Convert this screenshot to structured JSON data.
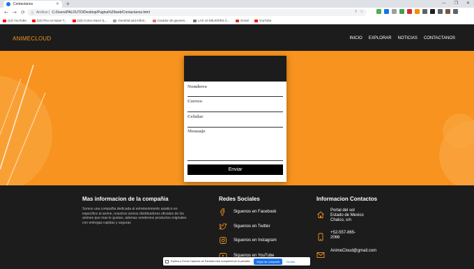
{
  "browser": {
    "tab_title": "Contactanos",
    "tab_close": "×",
    "new_tab": "+",
    "window_controls": [
      "—",
      "❐",
      "✕"
    ],
    "nav": {
      "back": "←",
      "forward": "→",
      "reload": "⟳"
    },
    "address": {
      "info_icon": "ⓘ",
      "scheme_label": "Archivo |",
      "url": "C:/Users/PALOUTO/Desktop/Pagina%20web/Contactanos.html"
    },
    "omnibox_actions": [
      "⇪",
      "☆"
    ],
    "bookmarks": [
      {
        "label": "(12) YouTube",
        "color": "#ff0000"
      },
      {
        "label": "(22) Pico vs Nane T...",
        "color": "#ff0000"
      },
      {
        "label": "(33) Como Hacer (L...",
        "color": "#ff0000"
      },
      {
        "label": "Genshid and Infinit...",
        "color": "#9e9e9e"
      },
      {
        "label": "Creador de guiones...",
        "color": "#e57373"
      },
      {
        "label": "LAS 10 MEJORES C...",
        "color": "#777777"
      },
      {
        "label": "Gmail",
        "color": "#d93025"
      },
      {
        "label": "YouTube",
        "color": "#ff0000"
      }
    ],
    "extension_colors": [
      "#4caf50",
      "#1a73e8",
      "#9e9e9e",
      "#43a047",
      "#d32f2f",
      "#fb8c00",
      "#5f6368",
      "#202124",
      "#5f6368",
      "#795548",
      "#5f6368"
    ]
  },
  "site": {
    "logo": "ANIMECLOUD",
    "menu": [
      "INICIO",
      "EXPLORAR",
      "NOTICIAS",
      "CONTACTANOS"
    ],
    "form": {
      "name_label": "Nombres",
      "email_label": "Correo",
      "phone_label": "Celular",
      "message_label": "Mensaje",
      "submit": "Enviar"
    },
    "footer": {
      "about_title": "Mas informacion de la compañia",
      "about_text": "Somos una compañia dedicada al entretenimiento asiatico en especifico al anime, nosotros somos distribuidores oficiales de los animes que mas le gustan, ademas vendemos productos originales con entregas rapidas y seguras",
      "social_title": "Redes Sociales",
      "social": [
        {
          "label": "Siguenos en Facebook",
          "icon": "facebook-icon"
        },
        {
          "label": "Siguenos en Twitter",
          "icon": "twitter-icon"
        },
        {
          "label": "Siguenos en Instagram",
          "icon": "instagram-icon"
        },
        {
          "label": "Siguenos en YouTube",
          "icon": "youtube-icon"
        }
      ],
      "contact_title": "Informacion Contactos",
      "address_lines": [
        "Portal del sol",
        "Estado de Mexico",
        "Chalco, s/n"
      ],
      "phone_lines": [
        "+52-557-865-",
        "2066"
      ],
      "email": "AnimeCloud@gmail.com"
    },
    "accent_color": "#f7931e"
  },
  "sharebar": {
    "text": "Explica y Envía Capturas de Pantalla está compartiendo tu pantalla.",
    "stop": "Dejar de compartir",
    "hide": "Ocultar"
  }
}
